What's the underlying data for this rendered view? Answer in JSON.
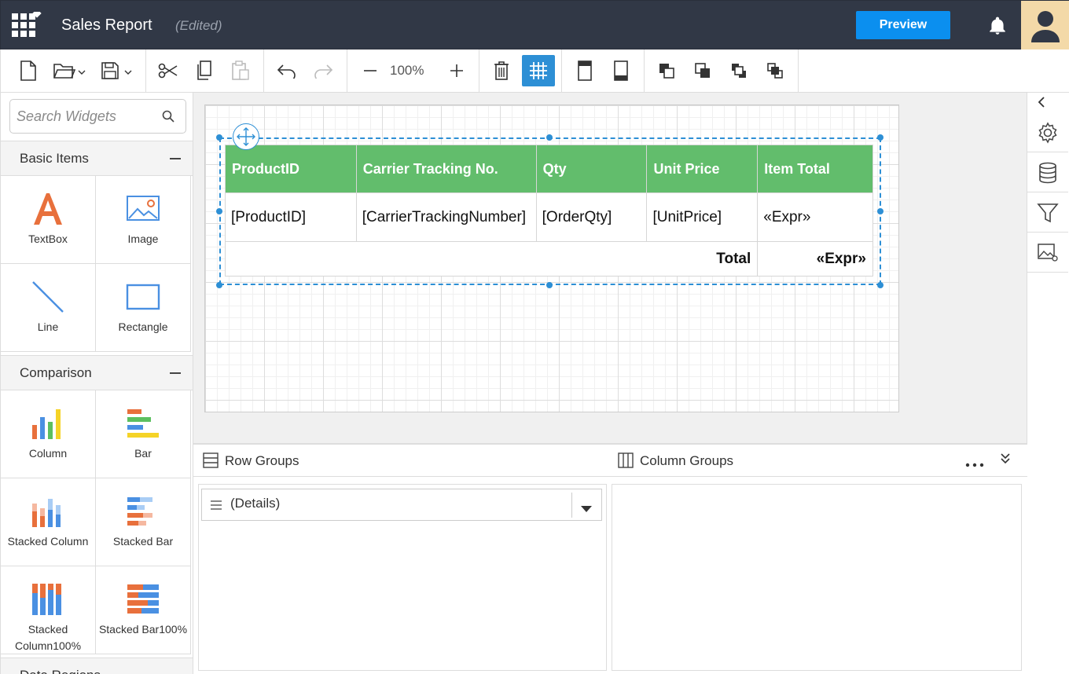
{
  "header": {
    "title": "Sales Report",
    "edited": "(Edited)",
    "preview_label": "Preview"
  },
  "toolbar": {
    "zoom": "100%"
  },
  "search": {
    "placeholder": "Search Widgets"
  },
  "sections": [
    {
      "title": "Basic Items"
    },
    {
      "title": "Comparison"
    },
    {
      "title": "Data Regions"
    }
  ],
  "widgets": {
    "textbox": "TextBox",
    "image": "Image",
    "line": "Line",
    "rectangle": "Rectangle",
    "column": "Column",
    "bar": "Bar",
    "stacked_column": "Stacked Column",
    "stacked_bar": "Stacked Bar",
    "stacked_column_100": "Stacked Column100%",
    "stacked_bar_100": "Stacked Bar100%"
  },
  "table": {
    "headers": [
      "ProductID",
      "Carrier Tracking No.",
      "Qty",
      "Unit Price",
      "Item Total"
    ],
    "row": [
      "[ProductID]",
      "[CarrierTrackingNumber]",
      "[OrderQty]",
      "[UnitPrice]",
      "«Expr»"
    ],
    "total_label": "Total",
    "total_value": "«Expr»"
  },
  "groups": {
    "row_groups": "Row Groups",
    "column_groups": "Column Groups",
    "details": "(Details)"
  },
  "colors": {
    "header_bg": "#313846",
    "accent": "#0b8fef",
    "table_header": "#62bd6c"
  }
}
